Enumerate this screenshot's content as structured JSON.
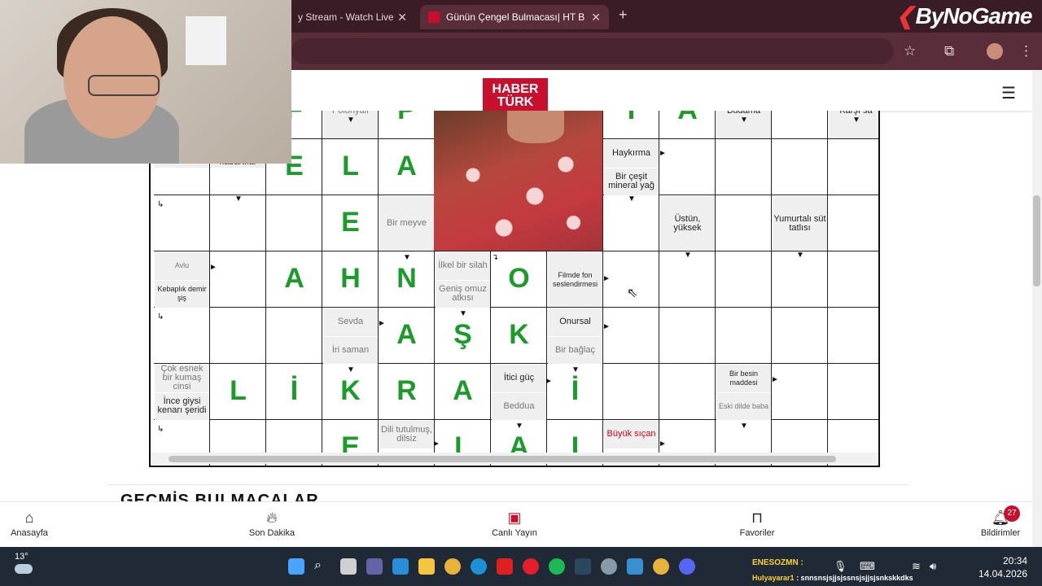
{
  "browser": {
    "tabs": [
      {
        "title": "y Stream - Watch Live"
      },
      {
        "title": "Günün Çengel Bulmacası| HT B"
      }
    ],
    "new_tab": "+",
    "close": "✕"
  },
  "stream_logo": "ByNoGame",
  "site": {
    "logo_line1": "HABER",
    "logo_line2": "TÜRK"
  },
  "puzzle": {
    "letters": [
      {
        "t": "F",
        "c": 2,
        "r": 0
      },
      {
        "t": "P",
        "c": 4,
        "r": 0
      },
      {
        "t": "T",
        "c": 8,
        "r": 0
      },
      {
        "t": "A",
        "c": 9,
        "r": 0
      },
      {
        "t": "E",
        "c": 2,
        "r": 1
      },
      {
        "t": "L",
        "c": 3,
        "r": 1
      },
      {
        "t": "A",
        "c": 4,
        "r": 1
      },
      {
        "t": "E",
        "c": 3,
        "r": 2
      },
      {
        "t": "A",
        "c": 2,
        "r": 3
      },
      {
        "t": "H",
        "c": 3,
        "r": 3
      },
      {
        "t": "N",
        "c": 4,
        "r": 3
      },
      {
        "t": "O",
        "c": 6,
        "r": 3
      },
      {
        "t": "A",
        "c": 4,
        "r": 4
      },
      {
        "t": "Ş",
        "c": 5,
        "r": 4
      },
      {
        "t": "K",
        "c": 6,
        "r": 4
      },
      {
        "t": "L",
        "c": 1,
        "r": 5
      },
      {
        "t": "İ",
        "c": 2,
        "r": 5
      },
      {
        "t": "K",
        "c": 3,
        "r": 5
      },
      {
        "t": "R",
        "c": 4,
        "r": 5
      },
      {
        "t": "A",
        "c": 5,
        "r": 5
      },
      {
        "t": "İ",
        "c": 7,
        "r": 5
      },
      {
        "t": "E",
        "c": 3,
        "r": 6
      },
      {
        "t": "L",
        "c": 5,
        "r": 6
      },
      {
        "t": "A",
        "c": 6,
        "r": 6
      },
      {
        "t": "I",
        "c": 7,
        "r": 6
      }
    ],
    "clues": {
      "polonyali": "Polonyalı",
      "budama": "Budama",
      "karsi": "Karşı sa",
      "haykirma": "Haykırma",
      "mineral": "Bir çeşit mineral yağ",
      "tokat": "Tokat ilçesi",
      "terle": "Terle oluşan pembe kabartılar",
      "meyve": "Bir meyve",
      "ustun": "Üstün, yüksek",
      "yumurtali": "Yumurtalı süt tatlısı",
      "avlu": "Avlu",
      "kebaplik": "Kebaplık demir şiş",
      "ilkel": "İlkel bir silah",
      "genis": "Geniş omuz atkısı",
      "filmde": "Filmde fon seslendirmesi",
      "sevda": "Sevda",
      "iri": "İri saman",
      "onursal": "Onursal",
      "bag": "Bir bağlaç",
      "esnek": "Çok esnek bir kumaş cinsi",
      "ince": "İnce giysi kenarı şeridi",
      "itici": "İtici güç",
      "beddua": "Beddua",
      "besin": "Bir besin maddesi",
      "eski": "Eski dilde baba",
      "dili": "Dili tutulmuş, dilsiz",
      "sican": "Büyük sıçan"
    }
  },
  "section_title": "GEÇMİŞ BULMACALAR",
  "bottom_nav": [
    {
      "label": "Anasayfa",
      "icon": "home-icon"
    },
    {
      "label": "Son Dakika",
      "icon": "flame-icon"
    },
    {
      "label": "Canlı Yayın",
      "icon": "tv-icon"
    },
    {
      "label": "Favoriler",
      "icon": "bookmark-icon"
    },
    {
      "label": "Bildirimler",
      "icon": "bell-icon"
    }
  ],
  "notifications_count": "27",
  "taskbar": {
    "temperature": "13°",
    "time": "20:34",
    "date": "14.04.2026",
    "chat_user1": "ENESOZMN :",
    "chat_user2": "Hulyayarar1",
    "chat_msg2": ": snnsnsjsjjsjssnsjsjjsjsnkskkdks"
  },
  "colors": {
    "brand": "#c8102e",
    "letters": "#1a9b2a",
    "chrome": "#5a2d3a"
  }
}
